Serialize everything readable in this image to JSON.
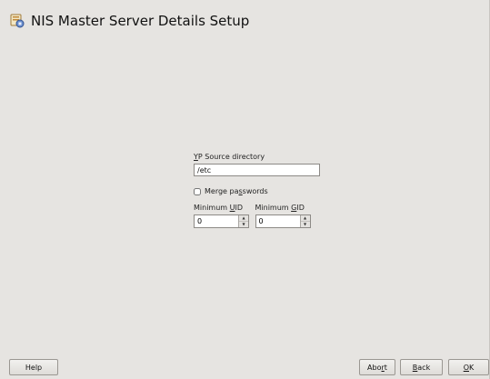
{
  "window": {
    "title": "NIS Master Server Details Setup",
    "icon": "nis-server-icon"
  },
  "form": {
    "yp_source": {
      "label_mnemonic": "Y",
      "label_rest": "P Source directory",
      "value": "/etc"
    },
    "merge_passwords": {
      "label_pre": "Merge pa",
      "label_mnemonic": "s",
      "label_post": "swords",
      "checked": false
    },
    "min_uid": {
      "label_pre": "Minimum ",
      "label_mnemonic": "U",
      "label_post": "ID",
      "value": "0"
    },
    "min_gid": {
      "label_pre": "Minimum ",
      "label_mnemonic": "G",
      "label_post": "ID",
      "value": "0"
    }
  },
  "buttons": {
    "help": {
      "pre": "",
      "mnemonic": "",
      "post": "Help"
    },
    "abort": {
      "pre": "Abo",
      "mnemonic": "r",
      "post": "t"
    },
    "back": {
      "pre": "",
      "mnemonic": "B",
      "post": "ack"
    },
    "ok": {
      "pre": "",
      "mnemonic": "O",
      "post": "K"
    }
  },
  "spinner_icons": {
    "up": "▲",
    "down": "▼"
  },
  "colors": {
    "background": "#e6e4e1",
    "field_border": "#8d8a86",
    "button_border": "#9a9792"
  }
}
